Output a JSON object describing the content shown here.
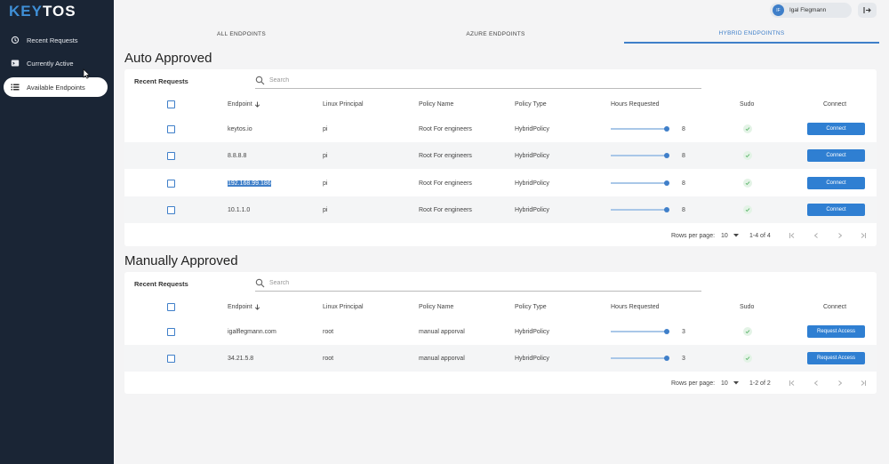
{
  "app": {
    "logo_prefix": "KEY",
    "logo_suffix": "TOS"
  },
  "sidebar": {
    "items": [
      {
        "label": "Recent Requests",
        "icon": "history-icon"
      },
      {
        "label": "Currently Active",
        "icon": "terminal-icon"
      },
      {
        "label": "Available Endpoints",
        "icon": "list-icon",
        "active": true
      }
    ]
  },
  "user": {
    "initials": "IF",
    "name": "Igal Flegmann"
  },
  "tabs": [
    {
      "label": "ALL ENDPOINTS"
    },
    {
      "label": "AZURE ENDPOINTS"
    },
    {
      "label": "HYBRID ENDPOINTNS",
      "active": true
    }
  ],
  "columns": [
    "Endpoint",
    "Linux Principal",
    "Policy Name",
    "Policy Type",
    "Hours Requested",
    "Sudo",
    "Connect"
  ],
  "auto": {
    "title": "Auto Approved",
    "label": "Recent Requests",
    "search_placeholder": "Search",
    "rows": [
      {
        "endpoint": "keytos.io",
        "principal": "pi",
        "policy": "Root For engineers",
        "type": "HybridPolicy",
        "hours": "8",
        "hours_fraction": 0.97,
        "sudo": true,
        "action": "Connect"
      },
      {
        "endpoint": "8.8.8.8",
        "principal": "pi",
        "policy": "Root For engineers",
        "type": "HybridPolicy",
        "hours": "8",
        "hours_fraction": 0.97,
        "sudo": true,
        "action": "Connect"
      },
      {
        "endpoint": "192.168.99.186",
        "principal": "pi",
        "policy": "Root For engineers",
        "type": "HybridPolicy",
        "hours": "8",
        "hours_fraction": 0.97,
        "sudo": true,
        "action": "Connect"
      },
      {
        "endpoint": "10.1.1.0",
        "principal": "pi",
        "policy": "Root For engineers",
        "type": "HybridPolicy",
        "hours": "8",
        "hours_fraction": 0.97,
        "sudo": true,
        "action": "Connect"
      }
    ],
    "pagination": {
      "rows_label": "Rows per page:",
      "rows_value": "10",
      "range": "1-4 of 4"
    }
  },
  "manual": {
    "title": "Manually Approved",
    "label": "Recent Requests",
    "search_placeholder": "Search",
    "rows": [
      {
        "endpoint": "igalflegmann.com",
        "principal": "root",
        "policy": "manual apporval",
        "type": "HybridPolicy",
        "hours": "3",
        "hours_fraction": 0.97,
        "sudo": true,
        "action": "Request Access"
      },
      {
        "endpoint": "34.21.5.8",
        "principal": "root",
        "policy": "manual apporval",
        "type": "HybridPolicy",
        "hours": "3",
        "hours_fraction": 0.97,
        "sudo": true,
        "action": "Request Access"
      }
    ],
    "pagination": {
      "rows_label": "Rows per page:",
      "rows_value": "10",
      "range": "1-2 of 2"
    }
  },
  "colors": {
    "sidebar": "#1a2535",
    "accent": "#3f7fc9",
    "button": "#2f7fd2"
  }
}
